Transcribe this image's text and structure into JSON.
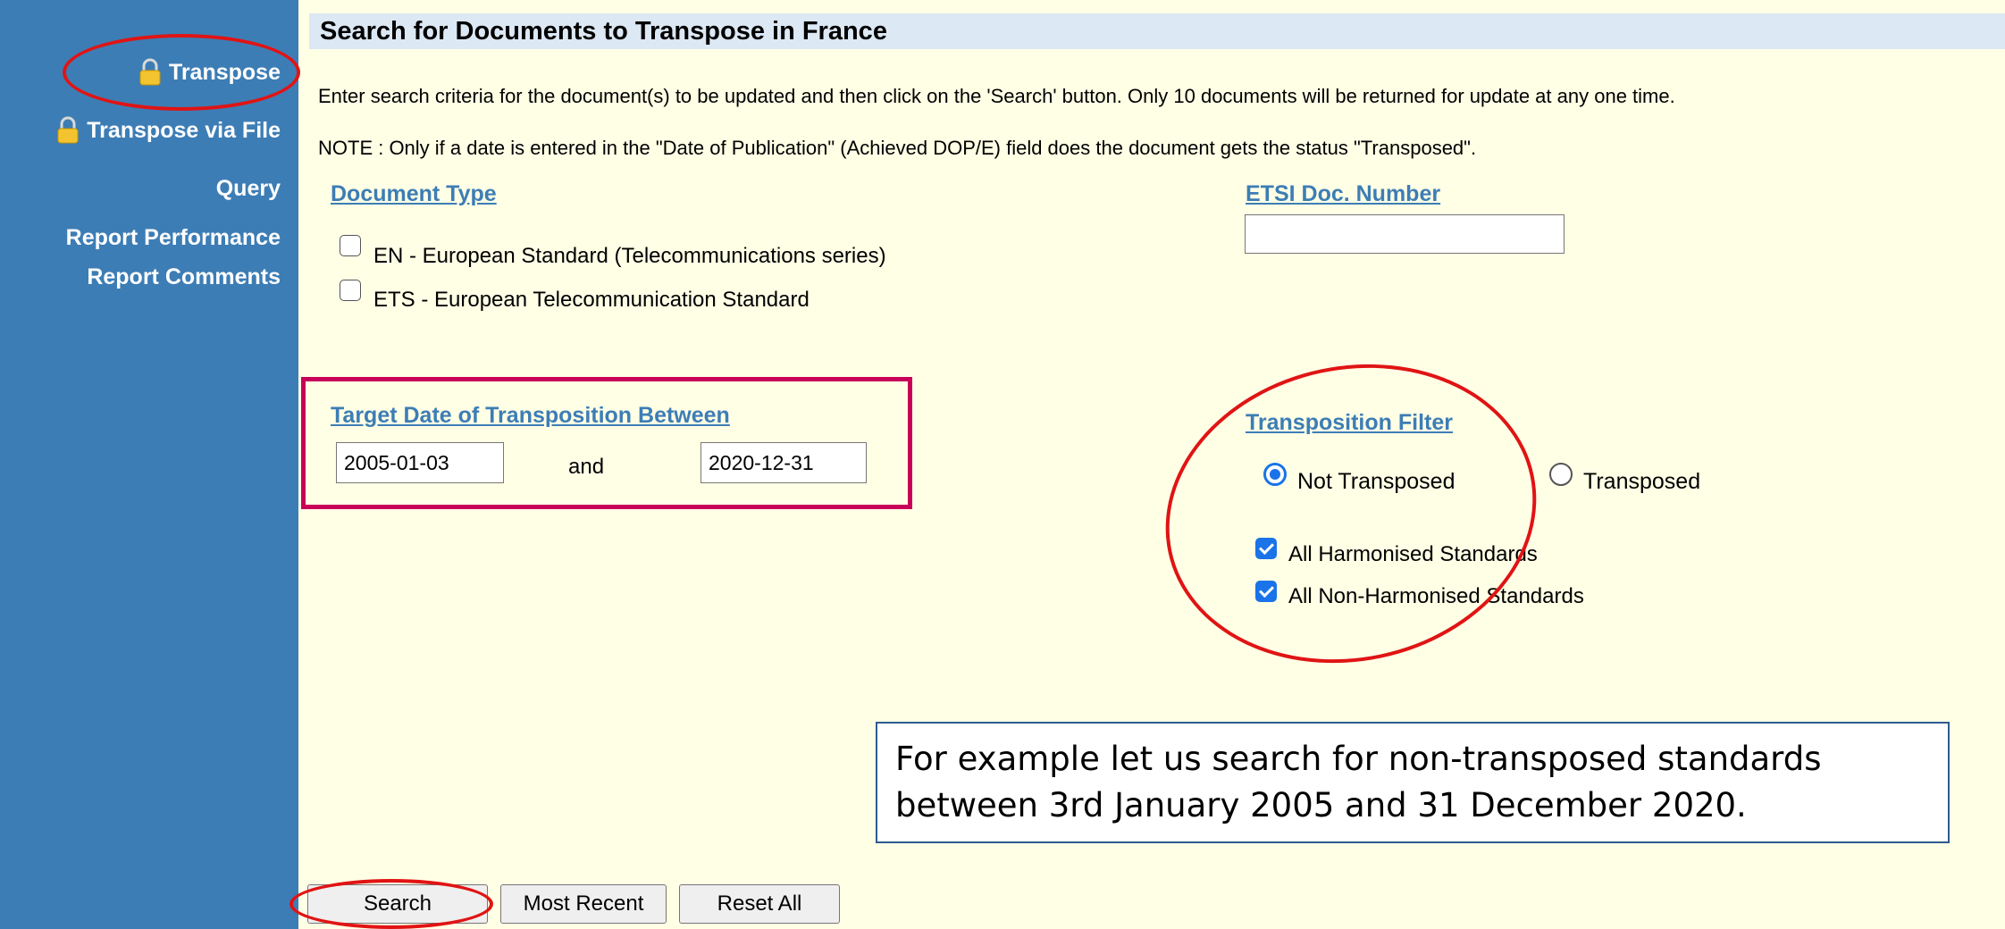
{
  "sidebar": {
    "items": [
      {
        "label": "Transpose",
        "icon": "lock-icon"
      },
      {
        "label": "Transpose via File",
        "icon": "lock-icon"
      },
      {
        "label": "Query"
      },
      {
        "label": "Report Performance"
      },
      {
        "label": "Report Comments"
      }
    ]
  },
  "page": {
    "title": "Search for Documents to Transpose in France",
    "instructions": "Enter search criteria for the document(s) to be updated and then click on the 'Search' button. Only 10 documents will be returned for update at any one time.",
    "note": "NOTE : Only if a date is entered in the  \"Date of Publication\" (Achieved DOP/E) field does the document gets the status \"Transposed\"."
  },
  "document_type": {
    "label": "Document Type",
    "options": [
      {
        "label": "EN - European Standard (Telecommunications series)",
        "checked": false
      },
      {
        "label": "ETS - European Telecommunication Standard",
        "checked": false
      }
    ]
  },
  "etsi_doc": {
    "label": "ETSI Doc. Number",
    "value": ""
  },
  "target_date": {
    "label": "Target Date of Transposition Between",
    "from": "2005-01-03",
    "and_label": "and",
    "to": "2020-12-31"
  },
  "filter": {
    "label": "Transposition Filter",
    "radios": [
      {
        "label": "Not Transposed",
        "selected": true
      },
      {
        "label": "Transposed",
        "selected": false
      }
    ],
    "checks": [
      {
        "label": "All Harmonised Standards",
        "checked": true
      },
      {
        "label": "All Non-Harmonised Standards",
        "checked": true
      }
    ]
  },
  "callout": {
    "line1": "For example let us search for non-transposed standards",
    "line2": "between 3rd January 2005 and 31 December 2020."
  },
  "buttons": {
    "search": "Search",
    "most_recent": "Most Recent",
    "reset_all": "Reset All"
  },
  "colors": {
    "sidebar": "#3d7db5",
    "background": "#ffffe6",
    "header_bar": "#dce8f4",
    "link": "#3d7db5",
    "annotation_red": "#e01414",
    "annotation_magenta": "#c8005a",
    "checkbox_blue": "#1a73e8"
  }
}
